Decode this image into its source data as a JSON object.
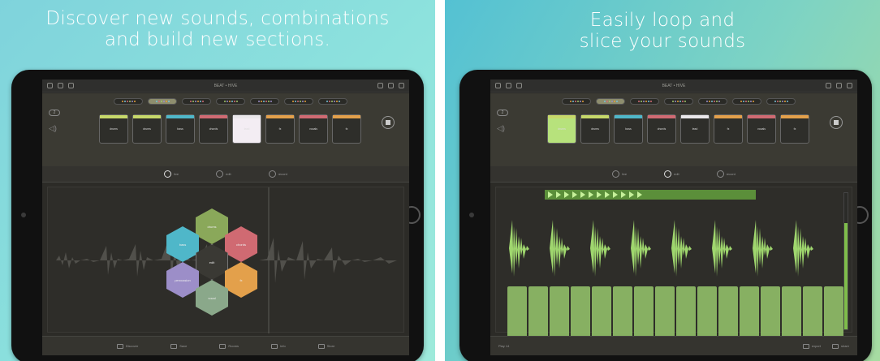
{
  "left": {
    "caption": [
      "Discover new sounds, combinations",
      "and build new sections."
    ],
    "app_title": "BEAT • HIVE",
    "presets": 7,
    "pad_labels": [
      "drums",
      "drums",
      "bass",
      "chords",
      "lead",
      "fx",
      "vocals",
      "fx"
    ],
    "pad_colors": [
      "#c7d86a",
      "#c7d86a",
      "#4fb7c9",
      "#d06a72",
      "#eae7ea",
      "#e3a04b",
      "#d06a72",
      "#e3a04b"
    ],
    "modes": [
      "live",
      "edit",
      "record"
    ],
    "hexes": [
      "drums",
      "bass",
      "chords",
      "edit",
      "percussion",
      "fx",
      "vocal"
    ],
    "bottom": [
      "Discover",
      "Save",
      "Rooms",
      "Info",
      "Store"
    ]
  },
  "right": {
    "caption": [
      "Easily loop and",
      "slice your sounds"
    ],
    "app_title": "BEAT • HIVE",
    "modes": [
      "live",
      "edit",
      "record"
    ],
    "bottom_right": [
      "export",
      "share"
    ],
    "bottom_left": "Play 14"
  },
  "colors": {
    "accent_green": "#96c86c",
    "hex_green": "#8aa85a",
    "hex_blue": "#4fb7c9",
    "hex_red": "#d06a72",
    "hex_orange": "#e3a04b",
    "hex_purple": "#9c8ec8"
  }
}
